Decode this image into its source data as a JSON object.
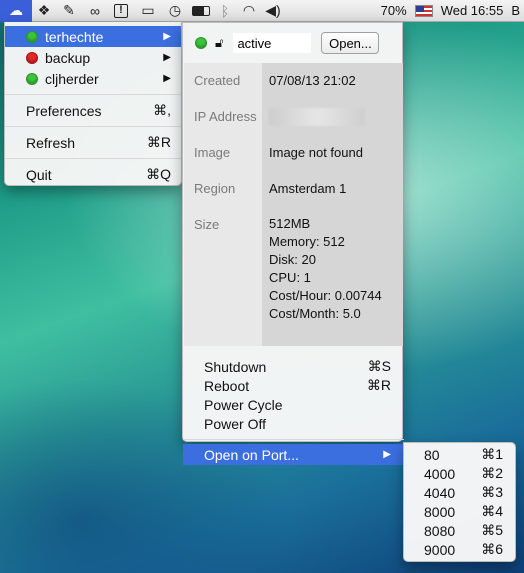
{
  "menubar": {
    "icons": [
      "cloud-icon",
      "dropbox-icon",
      "evernote-icon",
      "glasses-icon",
      "alert-icon",
      "airplay-icon",
      "time-machine-icon",
      "battery-icon",
      "bluetooth-icon",
      "wifi-icon",
      "volume-icon"
    ],
    "battery_percent": "70%",
    "clock": "Wed 16:55",
    "trailing": "B"
  },
  "main_menu": {
    "servers": [
      {
        "name": "terhechte",
        "status": "green",
        "selected": true
      },
      {
        "name": "backup",
        "status": "red",
        "selected": false
      },
      {
        "name": "cljherder",
        "status": "green",
        "selected": false
      }
    ],
    "preferences_label": "Preferences",
    "preferences_shortcut": "⌘,",
    "refresh_label": "Refresh",
    "refresh_shortcut": "⌘R",
    "quit_label": "Quit",
    "quit_shortcut": "⌘Q"
  },
  "server_menu": {
    "status_value": "active",
    "open_label": "Open...",
    "info": {
      "created_label": "Created",
      "created_value": "07/08/13 21:02",
      "ip_label": "IP Address",
      "image_label": "Image",
      "image_value": "Image not found",
      "region_label": "Region",
      "region_value": "Amsterdam 1",
      "size_label": "Size",
      "size_lines": [
        "512MB",
        "Memory: 512",
        "Disk: 20",
        "CPU: 1",
        "Cost/Hour: 0.00744",
        "Cost/Month: 5.0"
      ]
    },
    "actions": {
      "shutdown_label": "Shutdown",
      "shutdown_shortcut": "⌘S",
      "reboot_label": "Reboot",
      "reboot_shortcut": "⌘R",
      "power_cycle_label": "Power Cycle",
      "power_off_label": "Power Off",
      "open_port_label": "Open on Port..."
    }
  },
  "port_menu": {
    "items": [
      {
        "port": "80",
        "shortcut": "⌘1"
      },
      {
        "port": "4000",
        "shortcut": "⌘2"
      },
      {
        "port": "4040",
        "shortcut": "⌘3"
      },
      {
        "port": "8000",
        "shortcut": "⌘4"
      },
      {
        "port": "8080",
        "shortcut": "⌘5"
      },
      {
        "port": "9000",
        "shortcut": "⌘6"
      }
    ]
  },
  "colors": {
    "selection": "#3b6fe0",
    "status_green": "#3cc43c",
    "status_red": "#e22a2a"
  }
}
